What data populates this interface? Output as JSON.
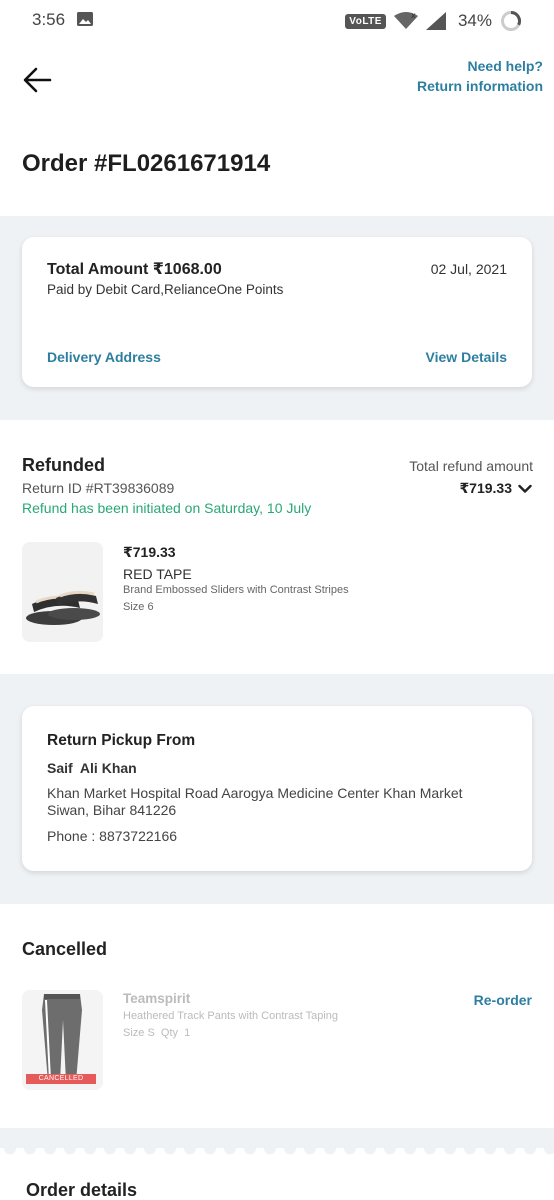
{
  "status_bar": {
    "time": "3:56",
    "network": "VoLTE",
    "battery": "34%"
  },
  "header": {
    "help_line1": "Need help?",
    "help_line2": "Return information",
    "order_title": "Order #FL0261671914"
  },
  "summary": {
    "total_amount": "Total Amount ₹1068.00",
    "date": "02 Jul, 2021",
    "paid_by": "Paid by Debit Card,RelianceOne Points",
    "delivery_address_link": "Delivery Address",
    "view_details_link": "View Details"
  },
  "refund": {
    "title": "Refunded",
    "return_id": "Return ID #RT39836089",
    "status_text": "Refund has been initiated on Saturday, 10 July",
    "total_label": "Total refund amount",
    "total_value": "₹719.33",
    "item": {
      "price": "₹719.33",
      "brand": "RED TAPE",
      "name": "Brand Embossed Sliders with Contrast Stripes",
      "size": "Size 6"
    }
  },
  "pickup": {
    "title": "Return Pickup From",
    "name": "Saif  Ali Khan",
    "address": "Khan Market Hospital Road Aarogya Medicine Center Khan Market Siwan, Bihar 841226",
    "phone": "Phone : 8873722166"
  },
  "cancelled": {
    "title": "Cancelled",
    "item": {
      "brand": "Teamspirit",
      "name": "Heathered Track Pants with Contrast Taping",
      "size_qty": "Size S  Qty  1",
      "tag": "CANCELLED"
    },
    "reorder_label": "Re-order"
  },
  "order_details": {
    "title": "Order details"
  },
  "colors": {
    "link": "#2d7fa1",
    "success": "#2aa874",
    "band": "#eff2f5",
    "cancel_tag": "#e65a5a"
  },
  "icons": [
    "image-icon",
    "wifi-icon",
    "signal-icon",
    "battery-icon",
    "back-arrow-icon",
    "chevron-down-icon"
  ]
}
